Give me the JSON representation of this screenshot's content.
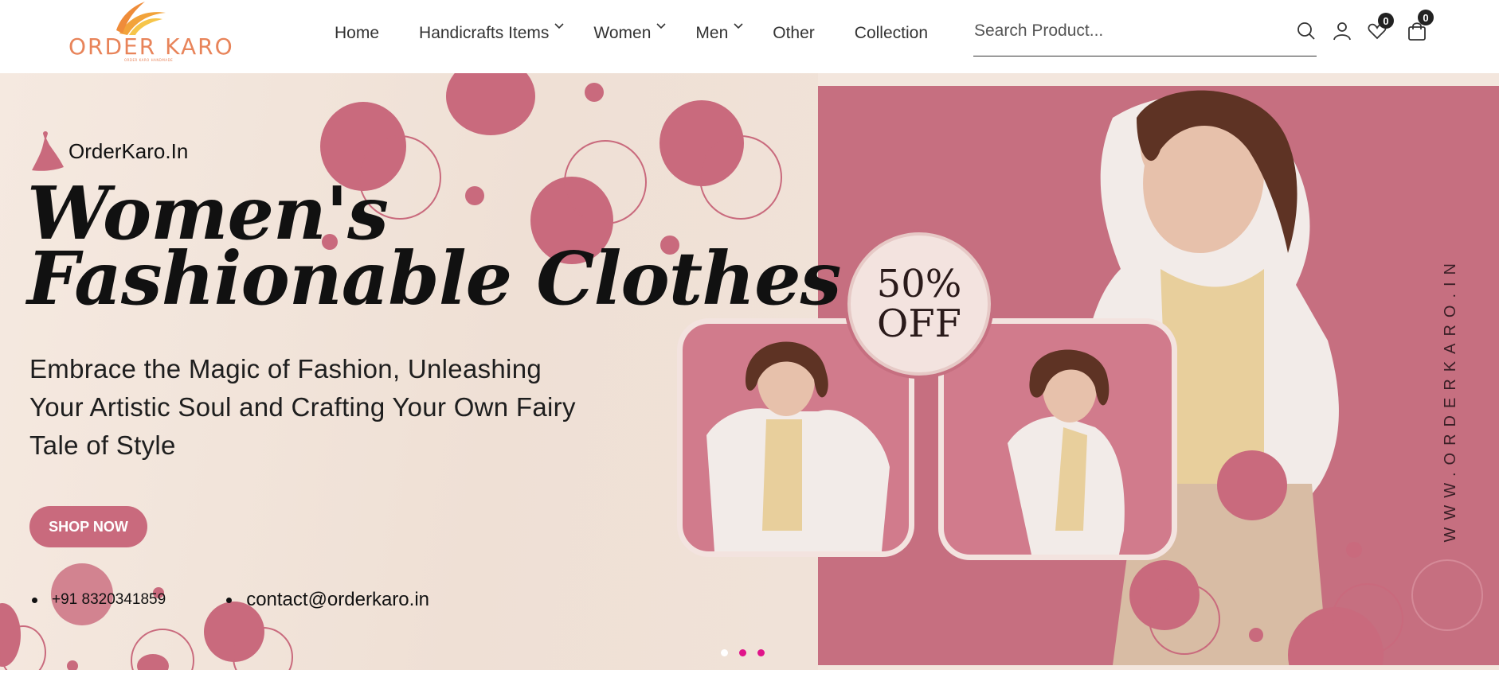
{
  "header": {
    "logo": {
      "text": "ORDER KARO",
      "tagline": "ORDER KARO HANDMADE"
    },
    "nav": [
      {
        "label": "Home",
        "dropdown": false
      },
      {
        "label": "Handicrafts Items",
        "dropdown": true
      },
      {
        "label": "Women",
        "dropdown": true
      },
      {
        "label": "Men",
        "dropdown": true
      },
      {
        "label": "Other",
        "dropdown": false
      },
      {
        "label": "Collection",
        "dropdown": false
      }
    ],
    "search": {
      "placeholder": "Search Product...",
      "value": ""
    },
    "icons": {
      "search": "search-icon",
      "account": "user-icon",
      "wishlist": "heart-icon",
      "cart": "shopping-bag-icon"
    },
    "wishlist_count": "0",
    "cart_count": "0"
  },
  "hero": {
    "brand": "OrderKaro.In",
    "headline_line1": "Women's",
    "headline_line2": "Fashionable Clothes",
    "subtitle": "Embrace the Magic of Fashion, Unleashing Your Artistic Soul and Crafting Your Own Fairy Tale of Style",
    "cta": "SHOP NOW",
    "phone": "+91 8320341859",
    "email": "contact@orderkaro.in",
    "offer_line1": "50%",
    "offer_line2": "OFF",
    "vertical_text": "WWW.ORDERKARO.IN",
    "slides": 3,
    "active_slide": 1
  },
  "colors": {
    "accent": "#c96a7d",
    "logo": "#e8845a",
    "background": "#f3e6dd",
    "pager_active": "#e0148a",
    "pager_inactive": "#ffffff"
  }
}
